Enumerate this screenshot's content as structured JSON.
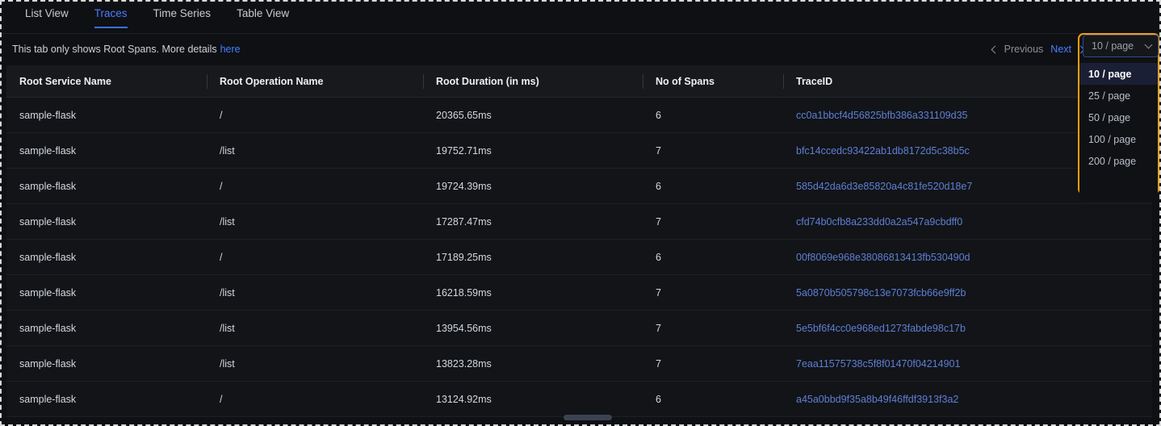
{
  "tabs": [
    {
      "label": "List View",
      "active": false
    },
    {
      "label": "Traces",
      "active": true
    },
    {
      "label": "Time Series",
      "active": false
    },
    {
      "label": "Table View",
      "active": false
    }
  ],
  "notice": {
    "text": "This tab only shows Root Spans. More details",
    "link_label": "here"
  },
  "pagination": {
    "previous_label": "Previous",
    "next_label": "Next",
    "previous_enabled": false,
    "next_enabled": true
  },
  "page_size_select": {
    "value": "10 / page",
    "expanded": true,
    "options": [
      {
        "label": "10 / page",
        "selected": true
      },
      {
        "label": "25 / page",
        "selected": false
      },
      {
        "label": "50 / page",
        "selected": false
      },
      {
        "label": "100 / page",
        "selected": false
      },
      {
        "label": "200 / page",
        "selected": false
      }
    ]
  },
  "table": {
    "columns": [
      "Root Service Name",
      "Root Operation Name",
      "Root Duration (in ms)",
      "No of Spans",
      "TraceID"
    ],
    "rows": [
      {
        "service": "sample-flask",
        "operation": "/",
        "duration": "20365.65ms",
        "spans": "6",
        "traceid": "cc0a1bbcf4d56825bfb386a331109d35"
      },
      {
        "service": "sample-flask",
        "operation": "/list",
        "duration": "19752.71ms",
        "spans": "7",
        "traceid": "bfc14ccedc93422ab1db8172d5c38b5c"
      },
      {
        "service": "sample-flask",
        "operation": "/",
        "duration": "19724.39ms",
        "spans": "6",
        "traceid": "585d42da6d3e85820a4c81fe520d18e7"
      },
      {
        "service": "sample-flask",
        "operation": "/list",
        "duration": "17287.47ms",
        "spans": "7",
        "traceid": "cfd74b0cfb8a233dd0a2a547a9cbdff0"
      },
      {
        "service": "sample-flask",
        "operation": "/",
        "duration": "17189.25ms",
        "spans": "6",
        "traceid": "00f8069e968e38086813413fb530490d"
      },
      {
        "service": "sample-flask",
        "operation": "/list",
        "duration": "16218.59ms",
        "spans": "7",
        "traceid": "5a0870b505798c13e7073fcb66e9ff2b"
      },
      {
        "service": "sample-flask",
        "operation": "/list",
        "duration": "13954.56ms",
        "spans": "7",
        "traceid": "5e5bf6f4cc0e968ed1273fabde98c17b"
      },
      {
        "service": "sample-flask",
        "operation": "/list",
        "duration": "13823.28ms",
        "spans": "7",
        "traceid": "7eaa11575738c5f8f01470f04214901"
      },
      {
        "service": "sample-flask",
        "operation": "/",
        "duration": "13124.92ms",
        "spans": "6",
        "traceid": "a45a0bbd9f35a8b49f46ffdf3913f3a2"
      }
    ]
  },
  "colors": {
    "accent_blue": "#4a7dff",
    "focus_orange": "#f59e0b",
    "trace_link": "#5f7fd4",
    "page_bg": "#0e1013",
    "table_bg": "#121418",
    "header_bg": "#17191d"
  }
}
